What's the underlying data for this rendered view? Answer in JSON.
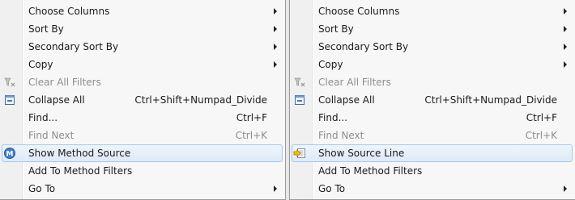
{
  "left_menu": {
    "items": [
      {
        "label": "Choose Columns",
        "shortcut": "",
        "submenu": true,
        "disabled": false,
        "selected": false,
        "icon": ""
      },
      {
        "label": "Sort By",
        "shortcut": "",
        "submenu": true,
        "disabled": false,
        "selected": false,
        "icon": ""
      },
      {
        "label": "Secondary Sort By",
        "shortcut": "",
        "submenu": true,
        "disabled": false,
        "selected": false,
        "icon": ""
      },
      {
        "label": "Copy",
        "shortcut": "",
        "submenu": true,
        "disabled": false,
        "selected": false,
        "icon": ""
      },
      {
        "label": "Clear All Filters",
        "shortcut": "",
        "submenu": false,
        "disabled": true,
        "selected": false,
        "icon": "clear-filters-icon"
      },
      {
        "label": "Collapse All",
        "shortcut": "Ctrl+Shift+Numpad_Divide",
        "submenu": false,
        "disabled": false,
        "selected": false,
        "icon": "collapse-all-icon"
      },
      {
        "label": "Find...",
        "shortcut": "Ctrl+F",
        "submenu": false,
        "disabled": false,
        "selected": false,
        "icon": ""
      },
      {
        "label": "Find Next",
        "shortcut": "Ctrl+K",
        "submenu": false,
        "disabled": true,
        "selected": false,
        "icon": ""
      },
      {
        "label": "Show Method Source",
        "shortcut": "",
        "submenu": false,
        "disabled": false,
        "selected": true,
        "icon": "method-source-icon"
      },
      {
        "label": "Add To Method Filters",
        "shortcut": "",
        "submenu": false,
        "disabled": false,
        "selected": false,
        "icon": ""
      },
      {
        "label": "Go To",
        "shortcut": "",
        "submenu": true,
        "disabled": false,
        "selected": false,
        "icon": ""
      }
    ]
  },
  "right_menu": {
    "items": [
      {
        "label": "Choose Columns",
        "shortcut": "",
        "submenu": true,
        "disabled": false,
        "selected": false,
        "icon": ""
      },
      {
        "label": "Sort By",
        "shortcut": "",
        "submenu": true,
        "disabled": false,
        "selected": false,
        "icon": ""
      },
      {
        "label": "Secondary Sort By",
        "shortcut": "",
        "submenu": true,
        "disabled": false,
        "selected": false,
        "icon": ""
      },
      {
        "label": "Copy",
        "shortcut": "",
        "submenu": true,
        "disabled": false,
        "selected": false,
        "icon": ""
      },
      {
        "label": "Clear All Filters",
        "shortcut": "",
        "submenu": false,
        "disabled": true,
        "selected": false,
        "icon": "clear-filters-icon"
      },
      {
        "label": "Collapse All",
        "shortcut": "Ctrl+Shift+Numpad_Divide",
        "submenu": false,
        "disabled": false,
        "selected": false,
        "icon": "collapse-all-icon"
      },
      {
        "label": "Find...",
        "shortcut": "Ctrl+F",
        "submenu": false,
        "disabled": false,
        "selected": false,
        "icon": ""
      },
      {
        "label": "Find Next",
        "shortcut": "Ctrl+K",
        "submenu": false,
        "disabled": true,
        "selected": false,
        "icon": ""
      },
      {
        "label": "Show Source Line",
        "shortcut": "",
        "submenu": false,
        "disabled": false,
        "selected": true,
        "icon": "source-line-icon"
      },
      {
        "label": "Add To Method Filters",
        "shortcut": "",
        "submenu": false,
        "disabled": false,
        "selected": false,
        "icon": ""
      },
      {
        "label": "Go To",
        "shortcut": "",
        "submenu": true,
        "disabled": false,
        "selected": false,
        "icon": ""
      }
    ]
  },
  "colors": {
    "menu_bg": "#f7f7f7",
    "selection_border": "#a8c8ec",
    "disabled_text": "#8d8d8d"
  }
}
